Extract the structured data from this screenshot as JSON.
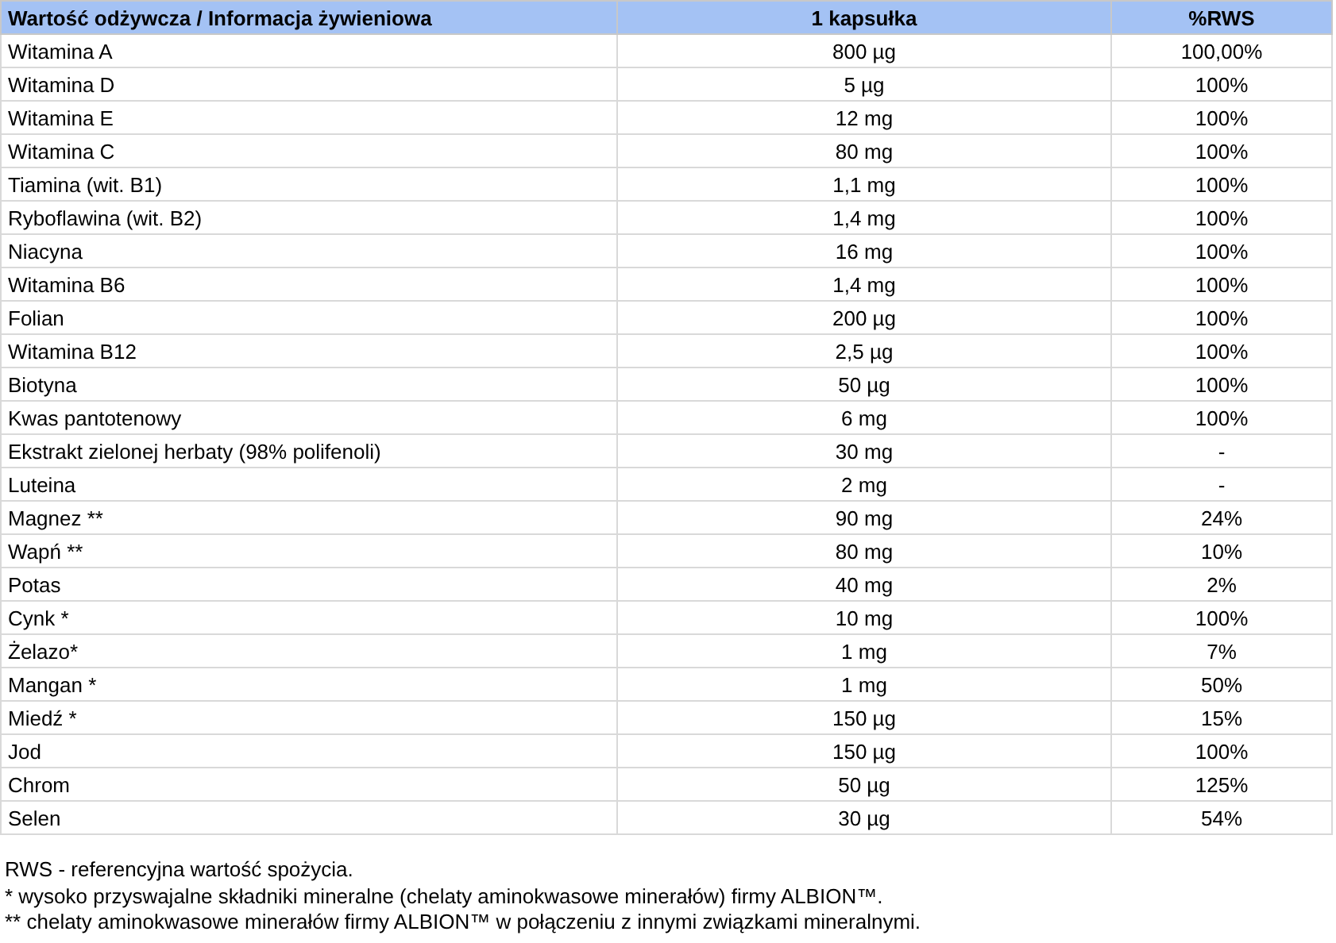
{
  "table": {
    "columns": [
      "Wartość odżywcza / Informacja żywieniowa",
      "1 kapsułka",
      "%RWS"
    ],
    "rows": [
      [
        "Witamina A",
        "800 µg",
        "100,00%"
      ],
      [
        "Witamina D",
        "5 µg",
        "100%"
      ],
      [
        "Witamina E",
        "12 mg",
        "100%"
      ],
      [
        "Witamina C",
        "80 mg",
        "100%"
      ],
      [
        "Tiamina (wit. B1)",
        "1,1 mg",
        "100%"
      ],
      [
        "Ryboflawina (wit. B2)",
        "1,4 mg",
        "100%"
      ],
      [
        "Niacyna",
        "16 mg",
        "100%"
      ],
      [
        "Witamina B6",
        "1,4 mg",
        "100%"
      ],
      [
        "Folian",
        "200 µg",
        "100%"
      ],
      [
        "Witamina B12",
        "2,5 µg",
        "100%"
      ],
      [
        "Biotyna",
        "50 µg",
        "100%"
      ],
      [
        "Kwas pantotenowy",
        "6 mg",
        "100%"
      ],
      [
        "Ekstrakt zielonej herbaty (98% polifenoli)",
        "30 mg",
        "-"
      ],
      [
        "Luteina",
        "2 mg",
        "-"
      ],
      [
        "Magnez **",
        "90 mg",
        "24%"
      ],
      [
        "Wapń **",
        "80 mg",
        "10%"
      ],
      [
        "Potas",
        "40 mg",
        "2%"
      ],
      [
        "Cynk *",
        "10 mg",
        "100%"
      ],
      [
        "Żelazo*",
        "1 mg",
        "7%"
      ],
      [
        "Mangan *",
        "1 mg",
        "50%"
      ],
      [
        "Miedź *",
        "150 µg",
        "15%"
      ],
      [
        "Jod",
        "150 µg",
        "100%"
      ],
      [
        "Chrom",
        "50 µg",
        "125%"
      ],
      [
        "Selen",
        "30 µg",
        "54%"
      ]
    ]
  },
  "notes": [
    "RWS - referencyjna wartość spożycia.",
    "* wysoko przyswajalne składniki mineralne (chelaty aminokwasowe minerałów) firmy ALBION™.",
    "** chelaty aminokwasowe minerałów firmy ALBION™ w połączeniu z innymi związkami mineralnymi."
  ]
}
